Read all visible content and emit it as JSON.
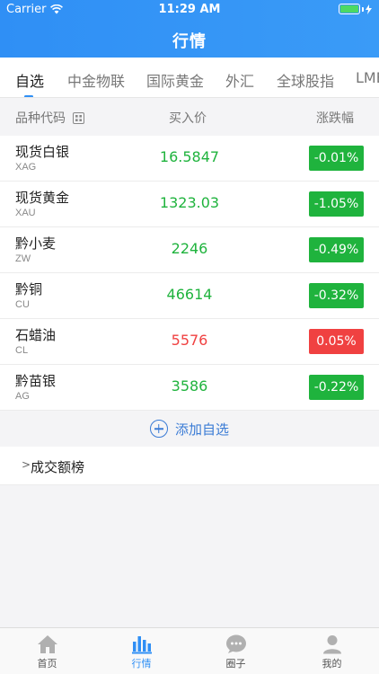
{
  "status_bar": {
    "carrier": "Carrier",
    "time": "11:29 AM"
  },
  "nav": {
    "title": "行情"
  },
  "tabs": [
    {
      "label": "自选",
      "active": true
    },
    {
      "label": "中金物联",
      "active": false
    },
    {
      "label": "国际黄金",
      "active": false
    },
    {
      "label": "外汇",
      "active": false
    },
    {
      "label": "全球股指",
      "active": false
    },
    {
      "label": "LME",
      "active": false
    }
  ],
  "columns": {
    "code": "品种代码",
    "price": "买入价",
    "change": "涨跌幅"
  },
  "rows": [
    {
      "name": "现货白银",
      "code": "XAG",
      "price": "16.5847",
      "change": "-0.01%",
      "direction": "up"
    },
    {
      "name": "现货黄金",
      "code": "XAU",
      "price": "1323.03",
      "change": "-1.05%",
      "direction": "up"
    },
    {
      "name": "黔小麦",
      "code": "ZW",
      "price": "2246",
      "change": "-0.49%",
      "direction": "up"
    },
    {
      "name": "黔铜",
      "code": "CU",
      "price": "46614",
      "change": "-0.32%",
      "direction": "up"
    },
    {
      "name": "石蜡油",
      "code": "CL",
      "price": "5576",
      "change": "0.05%",
      "direction": "down"
    },
    {
      "name": "黔苗银",
      "code": "AG",
      "price": "3586",
      "change": "-0.22%",
      "direction": "up"
    }
  ],
  "add_watchlist": "添加自选",
  "ranking": {
    "chevron": ">",
    "label": "成交额榜"
  },
  "tabbar": [
    {
      "label": "首页",
      "icon": "home-icon",
      "active": false
    },
    {
      "label": "行情",
      "icon": "chart-bar-icon",
      "active": true
    },
    {
      "label": "圈子",
      "icon": "chat-bubble-icon",
      "active": false
    },
    {
      "label": "我的",
      "icon": "user-icon",
      "active": false
    }
  ],
  "colors": {
    "accent": "#2f8ff5",
    "up": "#1fb33d",
    "down": "#f04141"
  }
}
